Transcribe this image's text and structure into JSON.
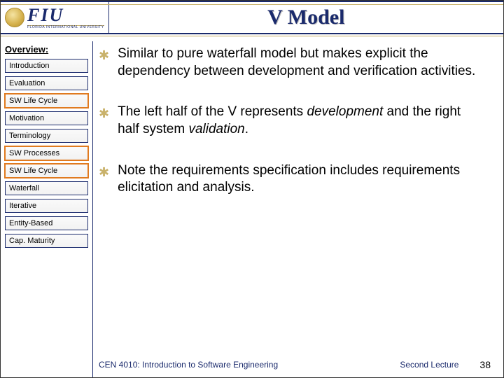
{
  "logo": {
    "abbr": "FIU",
    "full": "Florida International University"
  },
  "title": "V Model",
  "sidebar": {
    "heading": "Overview:",
    "items": [
      {
        "label": "Introduction",
        "highlight": false
      },
      {
        "label": "Evaluation",
        "highlight": false
      },
      {
        "label": "SW Life Cycle",
        "highlight": true
      },
      {
        "label": "Motivation",
        "highlight": false
      },
      {
        "label": "Terminology",
        "highlight": false
      },
      {
        "label": "SW Processes",
        "highlight": true
      },
      {
        "label": "SW Life Cycle",
        "highlight": true
      },
      {
        "label": "Waterfall",
        "highlight": false
      },
      {
        "label": "Iterative",
        "highlight": false
      },
      {
        "label": "Entity-Based",
        "highlight": false
      },
      {
        "label": "Cap. Maturity",
        "highlight": false
      }
    ]
  },
  "bullets": [
    {
      "pre": "Similar to pure waterfall model but makes explicit the dependency between development and verification activities.",
      "em1": "",
      "mid": "",
      "em2": "",
      "post": ""
    },
    {
      "pre": "The left half of the V represents ",
      "em1": "development",
      "mid": " and the right half system ",
      "em2": "validation",
      "post": "."
    },
    {
      "pre": "Note the requirements specification includes requirements elicitation and analysis.",
      "em1": "",
      "mid": "",
      "em2": "",
      "post": ""
    }
  ],
  "footer": {
    "course": "CEN 4010: Introduction to Software Engineering",
    "lecture": "Second Lecture",
    "page": "38"
  }
}
